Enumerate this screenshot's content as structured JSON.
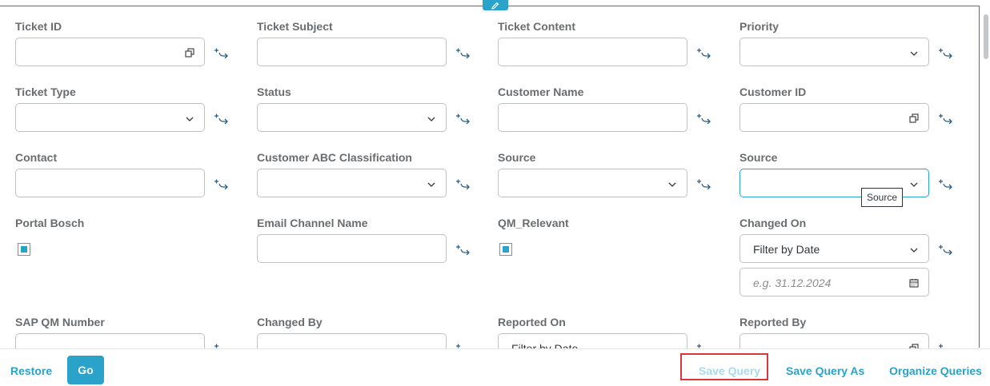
{
  "filters": [
    {
      "label": "Ticket ID",
      "type": "valuehelp"
    },
    {
      "label": "Ticket Subject",
      "type": "text"
    },
    {
      "label": "Ticket Content",
      "type": "text"
    },
    {
      "label": "Priority",
      "type": "select"
    },
    {
      "label": "Ticket Type",
      "type": "select"
    },
    {
      "label": "Status",
      "type": "select"
    },
    {
      "label": "Customer Name",
      "type": "text"
    },
    {
      "label": "Customer ID",
      "type": "valuehelp"
    },
    {
      "label": "Contact",
      "type": "text"
    },
    {
      "label": "Customer ABC Classification",
      "type": "select"
    },
    {
      "label": "Source",
      "type": "select"
    },
    {
      "label": "Source",
      "type": "select",
      "focused": true
    },
    {
      "label": "Portal Bosch",
      "type": "checkbox",
      "checked": true
    },
    {
      "label": "Email Channel Name",
      "type": "text"
    },
    {
      "label": "QM_Relevant",
      "type": "checkbox",
      "checked": true
    },
    {
      "label": "Changed On",
      "type": "date",
      "value": "Filter by Date",
      "placeholder": "e.g. 31.12.2024"
    },
    {
      "label": "SAP QM Number",
      "type": "text"
    },
    {
      "label": "Changed By",
      "type": "text"
    },
    {
      "label": "Reported On",
      "type": "select",
      "value": "Filter by Date"
    },
    {
      "label": "Reported By",
      "type": "valuehelp"
    }
  ],
  "tooltip": "Source",
  "footer": {
    "restore": "Restore",
    "go": "Go",
    "save_query": "Save Query",
    "save_query_as": "Save Query As",
    "organize_queries": "Organize Queries"
  },
  "colors": {
    "accent": "#2aa2c9",
    "highlight": "#d9363e"
  },
  "icons": [
    "pencil-icon",
    "value-help-icon",
    "chevron-down-icon",
    "add-to-query-icon",
    "calendar-icon"
  ]
}
